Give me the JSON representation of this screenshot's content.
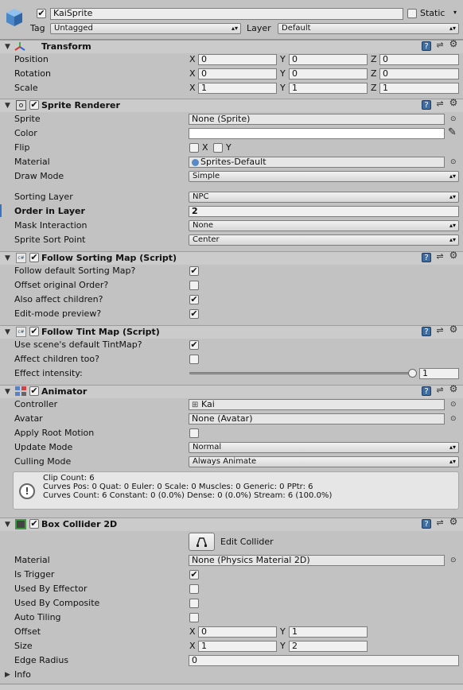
{
  "header": {
    "name": "KaiSprite",
    "static_label": "Static",
    "tag_label": "Tag",
    "tag_value": "Untagged",
    "layer_label": "Layer",
    "layer_value": "Default"
  },
  "transform": {
    "title": "Transform",
    "position_label": "Position",
    "rotation_label": "Rotation",
    "scale_label": "Scale",
    "x": "X",
    "y": "Y",
    "z": "Z",
    "position": [
      "0",
      "0",
      "0"
    ],
    "rotation": [
      "0",
      "0",
      "0"
    ],
    "scale": [
      "1",
      "1",
      "1"
    ]
  },
  "sprite_renderer": {
    "title": "Sprite Renderer",
    "sprite_label": "Sprite",
    "sprite_value": "None (Sprite)",
    "color_label": "Color",
    "flip_label": "Flip",
    "flip_x": "X",
    "flip_y": "Y",
    "material_label": "Material",
    "material_value": "Sprites-Default",
    "draw_mode_label": "Draw Mode",
    "draw_mode_value": "Simple",
    "sorting_layer_label": "Sorting Layer",
    "sorting_layer_value": "NPC",
    "order_label": "Order in Layer",
    "order_value": "2",
    "mask_label": "Mask Interaction",
    "mask_value": "None",
    "sort_point_label": "Sprite Sort Point",
    "sort_point_value": "Center"
  },
  "follow_sorting_map": {
    "title": "Follow Sorting Map (Script)",
    "rows": [
      {
        "label": "Follow default Sorting Map?",
        "checked": true
      },
      {
        "label": "Offset original Order?",
        "checked": false
      },
      {
        "label": "Also affect children?",
        "checked": true
      },
      {
        "label": "Edit-mode preview?",
        "checked": true
      }
    ]
  },
  "follow_tint_map": {
    "title": "Follow Tint Map (Script)",
    "rows": [
      {
        "label": "Use scene's default TintMap?",
        "checked": true
      },
      {
        "label": "Affect children too?",
        "checked": false
      }
    ],
    "intensity_label": "Effect intensity:",
    "intensity_value": "1",
    "intensity_fraction": 1.0
  },
  "animator": {
    "title": "Animator",
    "controller_label": "Controller",
    "controller_value": "Kai",
    "avatar_label": "Avatar",
    "avatar_value": "None (Avatar)",
    "root_motion_label": "Apply Root Motion",
    "update_mode_label": "Update Mode",
    "update_mode_value": "Normal",
    "culling_label": "Culling Mode",
    "culling_value": "Always Animate",
    "info_line1": "Clip Count: 6",
    "info_line2": "Curves Pos: 0 Quat: 0 Euler: 0 Scale: 0 Muscles: 0 Generic: 0 PPtr: 6",
    "info_line3": "Curves Count: 6 Constant: 0 (0.0%) Dense: 0 (0.0%) Stream: 6 (100.0%)"
  },
  "box_collider": {
    "title": "Box Collider 2D",
    "edit_label": "Edit Collider",
    "material_label": "Material",
    "material_value": "None (Physics Material 2D)",
    "is_trigger_label": "Is Trigger",
    "used_by_effector_label": "Used By Effector",
    "used_by_composite_label": "Used By Composite",
    "auto_tiling_label": "Auto Tiling",
    "offset_label": "Offset",
    "offset_x": "0",
    "offset_y": "1",
    "size_label": "Size",
    "size_x": "1",
    "size_y": "2",
    "edge_radius_label": "Edge Radius",
    "edge_radius_value": "0",
    "info_label": "Info"
  },
  "icons": [
    "cube-icon",
    "transform-axes-icon",
    "sprite-renderer-icon",
    "script-icon",
    "animator-icon",
    "box-collider-icon",
    "help-icon",
    "presets-icon",
    "gear-icon",
    "object-picker-icon",
    "eyedropper-icon",
    "warning-info-icon",
    "edit-collider-icon"
  ],
  "colors": {
    "panel": "#c2c2c2",
    "header": "#cbcbcb",
    "help_icon": "#3f6da0",
    "focus": "#3a72c2"
  }
}
